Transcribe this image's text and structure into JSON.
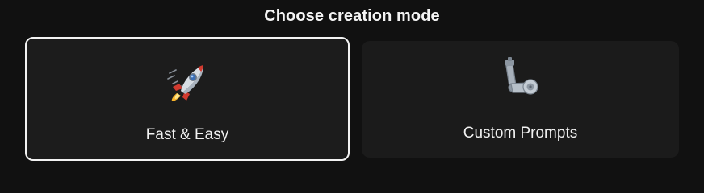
{
  "header": {
    "title": "Choose creation mode"
  },
  "modes": [
    {
      "label": "Fast & Easy",
      "icon": "rocket-icon",
      "selected": true
    },
    {
      "label": "Custom Prompts",
      "icon": "mechanical-arm-icon",
      "selected": false
    }
  ],
  "colors": {
    "background": "#111111",
    "card": "#1c1c1c",
    "selected_border": "#f2f2f2",
    "text": "#f2f2f2"
  }
}
